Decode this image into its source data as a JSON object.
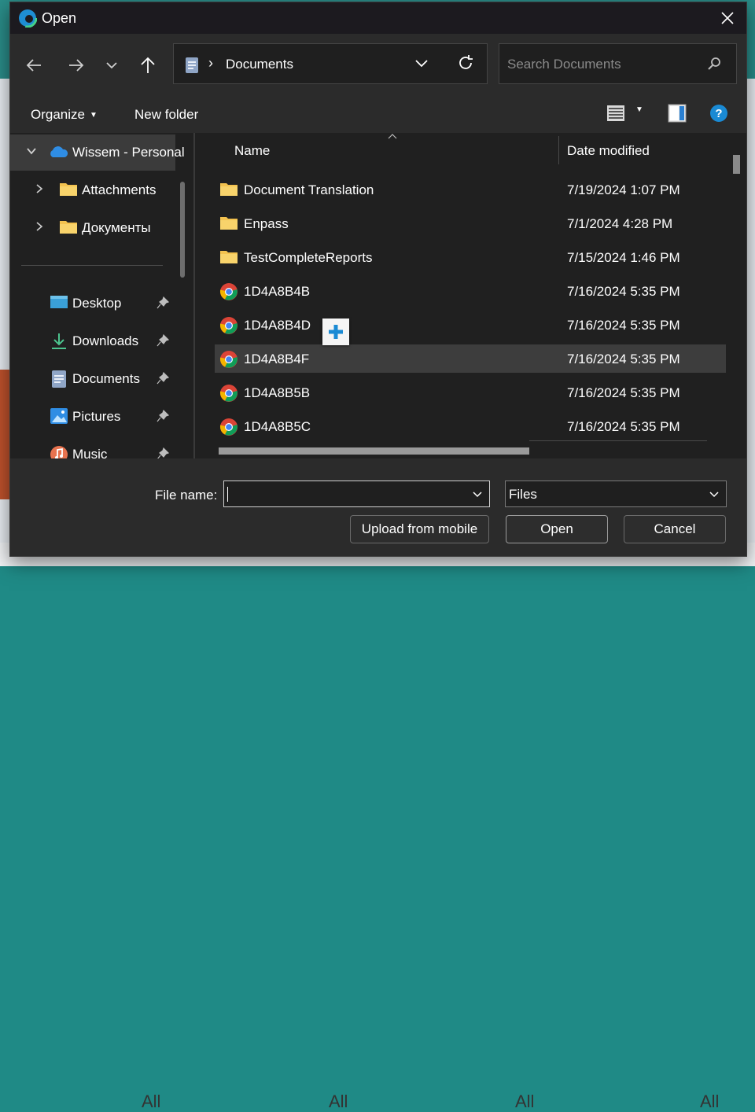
{
  "window": {
    "title": "Open"
  },
  "address": {
    "path_label": "Documents"
  },
  "search": {
    "placeholder": "Search Documents"
  },
  "toolbar": {
    "organize_label": "Organize",
    "new_folder_label": "New folder"
  },
  "nav": {
    "tree": [
      {
        "label": "Wissem - Personal",
        "icon": "onedrive-icon"
      },
      {
        "label": "Attachments",
        "icon": "folder-icon"
      },
      {
        "label": "Документы",
        "icon": "folder-icon"
      }
    ],
    "quick_access": [
      {
        "label": "Desktop",
        "icon": "desktop-icon"
      },
      {
        "label": "Downloads",
        "icon": "download-icon"
      },
      {
        "label": "Documents",
        "icon": "document-icon"
      },
      {
        "label": "Pictures",
        "icon": "pictures-icon"
      },
      {
        "label": "Music",
        "icon": "music-icon"
      }
    ]
  },
  "list": {
    "columns": {
      "name": "Name",
      "date": "Date modified"
    },
    "rows": [
      {
        "name": "Document Translation",
        "date": "7/19/2024 1:07 PM",
        "icon": "folder-icon"
      },
      {
        "name": "Enpass",
        "date": "7/1/2024 4:28 PM",
        "icon": "folder-icon"
      },
      {
        "name": "TestCompleteReports",
        "date": "7/15/2024 1:46 PM",
        "icon": "folder-icon"
      },
      {
        "name": "1D4A8B4B",
        "date": "7/16/2024 5:35 PM",
        "icon": "chrome-icon"
      },
      {
        "name": "1D4A8B4D",
        "date": "7/16/2024 5:35 PM",
        "icon": "chrome-icon"
      },
      {
        "name": "1D4A8B4F",
        "date": "7/16/2024 5:35 PM",
        "icon": "chrome-icon",
        "selected": true
      },
      {
        "name": "1D4A8B5B",
        "date": "7/16/2024 5:35 PM",
        "icon": "chrome-icon"
      },
      {
        "name": "1D4A8B5C",
        "date": "7/16/2024 5:35 PM",
        "icon": "chrome-icon"
      }
    ]
  },
  "footer": {
    "file_name_label": "File name:",
    "file_name_value": "",
    "file_type_value": "Files",
    "upload_label": "Upload from mobile",
    "open_label": "Open",
    "cancel_label": "Cancel"
  },
  "background": {
    "tab_label": "All"
  },
  "colors": {
    "accent": "#1a8ad4",
    "selection": "#3d3d3d",
    "dialog_bg": "#202020"
  }
}
